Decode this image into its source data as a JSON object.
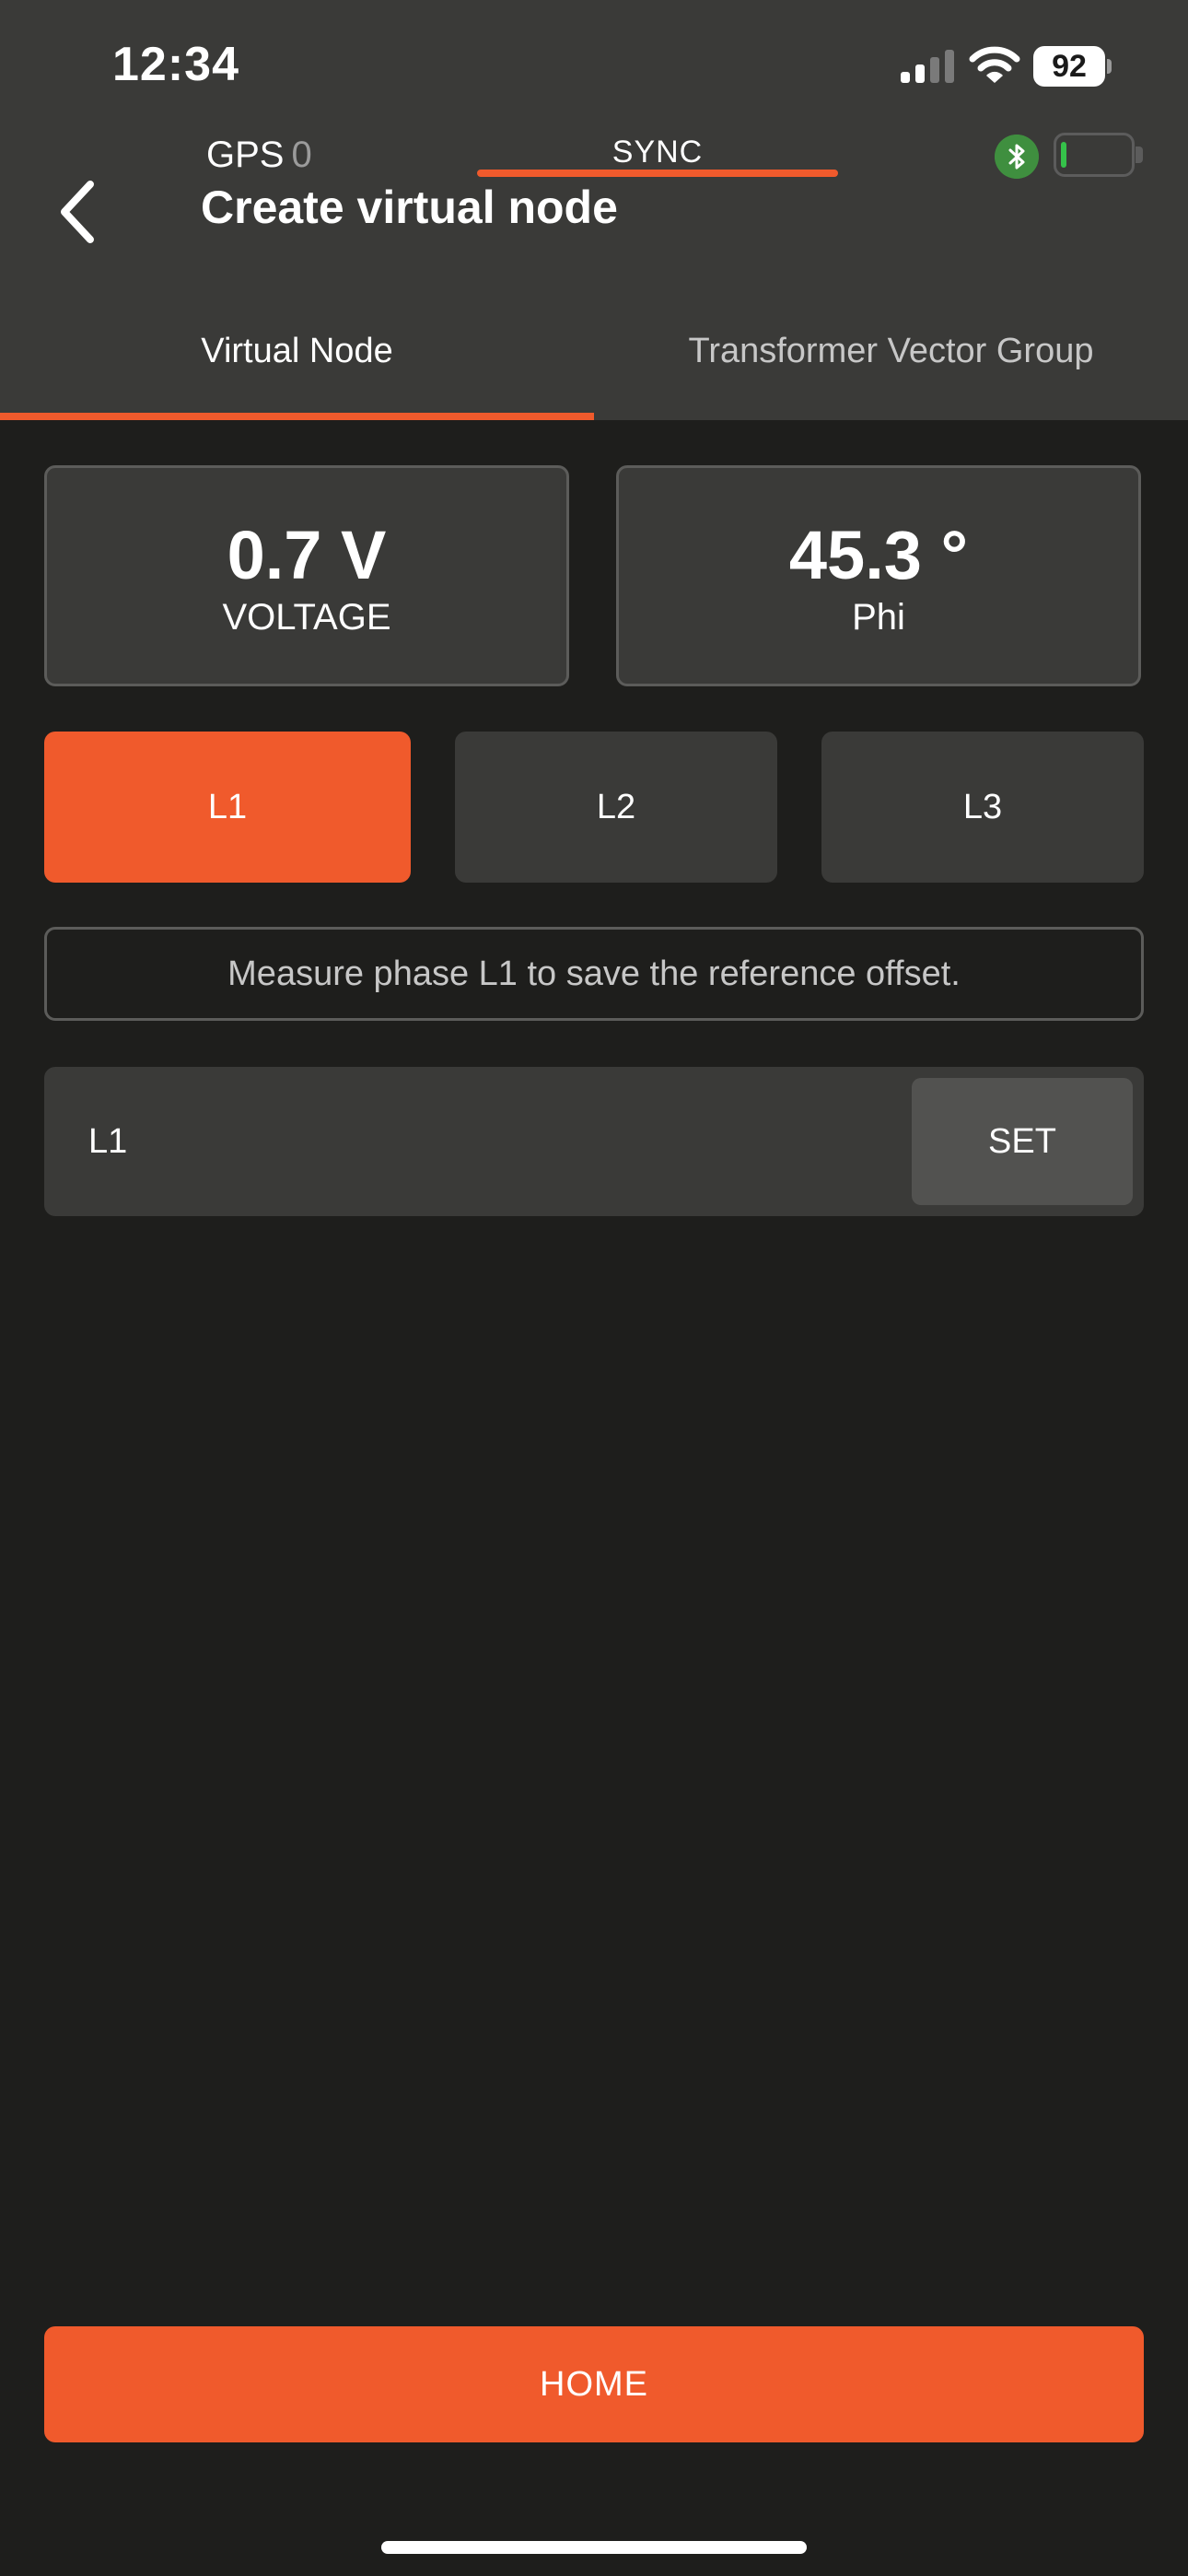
{
  "status_bar": {
    "time": "12:34",
    "battery_percent": "92",
    "signal_bars_active": 2,
    "signal_bars_total": 4
  },
  "header": {
    "gps_label": "GPS",
    "gps_count": "0",
    "sync_label": "SYNC",
    "title": "Create virtual node",
    "device_battery_level": 0.05,
    "colors": {
      "accent": "#f05a2c",
      "bluetooth": "#3f8f3f",
      "battery_fill": "#35c24a"
    }
  },
  "tabs": [
    {
      "label": "Virtual Node",
      "active": true
    },
    {
      "label": "Transformer Vector Group",
      "active": false
    }
  ],
  "metrics": {
    "voltage": {
      "value": "0.7 V",
      "label": "VOLTAGE"
    },
    "phi": {
      "value": "45.3 °",
      "label": "Phi"
    }
  },
  "phases": [
    {
      "label": "L1",
      "selected": true
    },
    {
      "label": "L2",
      "selected": false
    },
    {
      "label": "L3",
      "selected": false
    }
  ],
  "info_message": "Measure phase L1 to save the reference offset.",
  "set_row": {
    "label": "L1",
    "button_label": "SET"
  },
  "footer": {
    "home_label": "HOME"
  },
  "icons": {
    "back": "chevron-left-icon",
    "signal": "cellular-signal-icon",
    "wifi": "wifi-icon",
    "bluetooth": "bluetooth-icon",
    "device_battery": "battery-icon"
  }
}
